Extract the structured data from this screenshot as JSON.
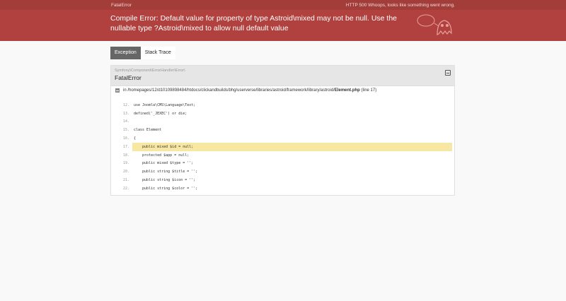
{
  "header": {
    "title": "FatalError",
    "status": "HTTP 500 Whoops, looks like something went wrong.",
    "message": "Compile Error: Default value for property of type Astroid\\mixed may not be null. Use the nullable type ?Astroid\\mixed to allow null default value"
  },
  "tabs": [
    {
      "label": "Exception"
    },
    {
      "label": "Stack Trace"
    }
  ],
  "exception": {
    "namespace": "Symfony\\Component\\ErrorHandler\\Error\\",
    "class": "FatalError",
    "file_prefix": "in /homepages/12/d10109898484/htdocs/clickandbuilds/bhg/userverse/libraries/astroid/framework/library/astroid/",
    "file_name": "Element.php",
    "file_suffix": "(line 17)"
  },
  "code_lines": [
    {
      "n": "12.",
      "code": "use Joomla\\CMS\\Language\\Text;"
    },
    {
      "n": "13.",
      "code": "defined('_JEXEC') or die;"
    },
    {
      "n": "14.",
      "code": ""
    },
    {
      "n": "15.",
      "code": "class Element"
    },
    {
      "n": "16.",
      "code": "{"
    },
    {
      "n": "17.",
      "code": "    public mixed $id = null;"
    },
    {
      "n": "18.",
      "code": "    protected $app = null;"
    },
    {
      "n": "19.",
      "code": "    public mixed $type = '';"
    },
    {
      "n": "20.",
      "code": "    public string $title = '';"
    },
    {
      "n": "21.",
      "code": "    public string $icon = '';"
    },
    {
      "n": "22.",
      "code": "    public string $color = '';"
    }
  ],
  "highlight_line": "17.",
  "colors": {
    "header_bg": "#b0413e",
    "highlight": "#f7e7a3"
  }
}
